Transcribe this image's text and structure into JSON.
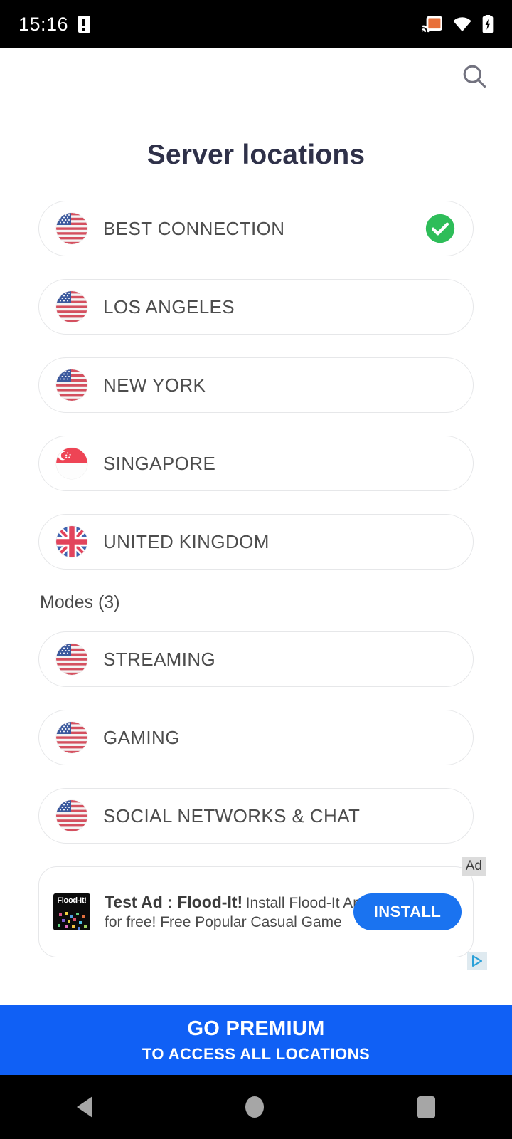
{
  "status_bar": {
    "time": "15:16",
    "icons": [
      "sim-card-icon",
      "cast-icon",
      "wifi-icon",
      "battery-charging-icon"
    ],
    "cast_color": "#e8703a",
    "background": "#000000"
  },
  "app_bar": {
    "search_icon": "search-icon",
    "search_color": "#72727f"
  },
  "header": {
    "title": "Server locations",
    "title_color": "#2f3149"
  },
  "locations": [
    {
      "label": "BEST CONNECTION",
      "flag": "us-flag-icon",
      "selected": true
    },
    {
      "label": "LOS ANGELES",
      "flag": "us-flag-icon",
      "selected": false
    },
    {
      "label": "NEW YORK",
      "flag": "us-flag-icon",
      "selected": false
    },
    {
      "label": "SINGAPORE",
      "flag": "sg-flag-icon",
      "selected": false
    },
    {
      "label": "UNITED KINGDOM",
      "flag": "gb-flag-icon",
      "selected": false
    }
  ],
  "modes_section": {
    "label": "Modes (3)",
    "items": [
      {
        "label": "STREAMING",
        "flag": "us-flag-icon"
      },
      {
        "label": "GAMING",
        "flag": "us-flag-icon"
      },
      {
        "label": "SOCIAL NETWORKS & CHAT",
        "flag": "us-flag-icon"
      }
    ]
  },
  "ad": {
    "badge": "Ad",
    "icon_label": "Flood-It!",
    "title": "Test Ad : Flood-It!",
    "description": "Install Flood-It App for free! Free Popular Casual Game",
    "install_label": "INSTALL",
    "install_color": "#1a73f0",
    "adchoices_icon": "adchoices-icon"
  },
  "premium_banner": {
    "main": "GO PREMIUM",
    "sub": "TO ACCESS ALL LOCATIONS",
    "background": "#1060f5"
  },
  "nav_bar": {
    "back": "back-icon",
    "home": "home-icon",
    "recents": "recents-icon"
  },
  "theme": {
    "check_green": "#2ebd59",
    "card_border": "#e6e7e9",
    "label_gray": "#4d4d4d"
  }
}
